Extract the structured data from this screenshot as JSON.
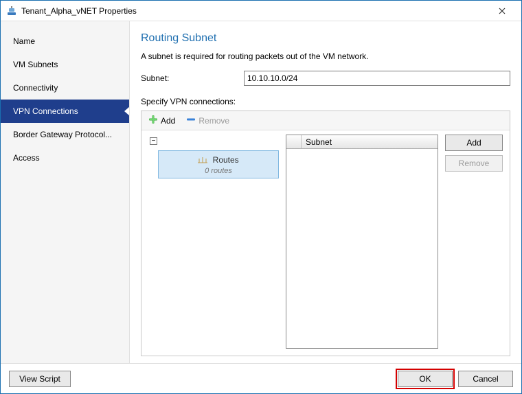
{
  "window": {
    "title": "Tenant_Alpha_vNET Properties"
  },
  "sidebar": {
    "items": [
      {
        "label": "Name"
      },
      {
        "label": "VM Subnets"
      },
      {
        "label": "Connectivity"
      },
      {
        "label": "VPN Connections"
      },
      {
        "label": "Border Gateway Protocol..."
      },
      {
        "label": "Access"
      }
    ],
    "selected_index": 3
  },
  "page": {
    "title": "Routing Subnet",
    "description": "A subnet is required for routing packets out of the VM network.",
    "subnet_label": "Subnet:",
    "subnet_value": "10.10.10.0/24",
    "specify_label": "Specify VPN connections:"
  },
  "toolbar": {
    "add_label": "Add",
    "remove_label": "Remove"
  },
  "tree": {
    "toggle_glyph": "⊟",
    "routes_label": "Routes",
    "routes_count": "0 routes"
  },
  "subnet_list": {
    "header": "Subnet",
    "add_label": "Add",
    "remove_label": "Remove"
  },
  "footer": {
    "view_script": "View Script",
    "ok": "OK",
    "cancel": "Cancel"
  }
}
